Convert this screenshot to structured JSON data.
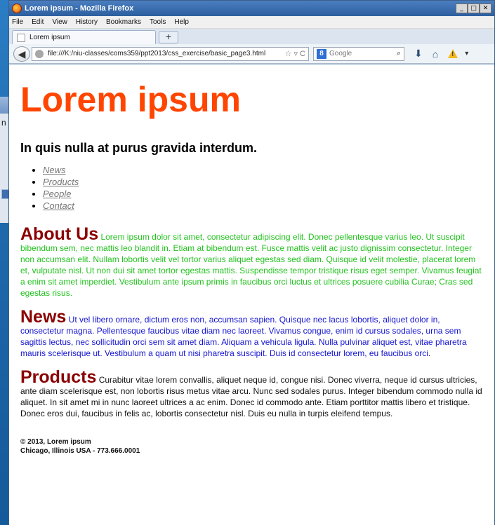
{
  "window": {
    "title": "Lorem ipsum - Mozilla Firefox",
    "controls": {
      "minimize": "_",
      "maximize": "□",
      "close": "✕"
    }
  },
  "menu": [
    {
      "label": "File"
    },
    {
      "label": "Edit"
    },
    {
      "label": "View"
    },
    {
      "label": "History"
    },
    {
      "label": "Bookmarks"
    },
    {
      "label": "Tools"
    },
    {
      "label": "Help"
    }
  ],
  "tab": {
    "title": "Lorem ipsum",
    "new_tab": "+"
  },
  "navbar": {
    "url": "file:///K:/niu-classes/coms359/ppt2013/css_exercise/basic_page3.html",
    "search_placeholder": "Google",
    "search_engine_badge": "8"
  },
  "page": {
    "title": "Lorem ipsum",
    "subtitle": "In quis nulla at purus gravida interdum.",
    "nav": [
      "News",
      "Products",
      "People",
      "Contact"
    ],
    "about": {
      "heading": "About Us",
      "text": "Lorem ipsum dolor sit amet, consectetur adipiscing elit. Donec pellentesque varius leo. Ut suscipit bibendum sem, nec mattis leo blandit in. Etiam at bibendum est. Fusce mattis velit ac justo dignissim consectetur. Integer non accumsan elit. Nullam lobortis velit vel tortor varius aliquet egestas sed diam. Quisque id velit molestie, placerat lorem et, vulputate nisl. Ut non dui sit amet tortor egestas mattis. Suspendisse tempor tristique risus eget semper. Vivamus feugiat a enim sit amet imperdiet. Vestibulum ante ipsum primis in faucibus orci luctus et ultrices posuere cubilia Curae; Cras sed egestas risus."
    },
    "news": {
      "heading": "News",
      "text": "Ut vel libero ornare, dictum eros non, accumsan sapien. Quisque nec lacus lobortis, aliquet dolor in, consectetur magna. Pellentesque faucibus vitae diam nec laoreet. Vivamus congue, enim id cursus sodales, urna sem sagittis lectus, nec sollicitudin orci sem sit amet diam. Aliquam a vehicula ligula. Nulla pulvinar aliquet est, vitae pharetra mauris scelerisque ut. Vestibulum a quam ut nisi pharetra suscipit. Duis id consectetur lorem, eu faucibus orci."
    },
    "products": {
      "heading": "Products",
      "text": "Curabitur vitae lorem convallis, aliquet neque id, congue nisi. Donec viverra, neque id cursus ultricies, ante diam scelerisque est, non lobortis risus metus vitae arcu. Nunc sed sodales purus. Integer bibendum commodo nulla id aliquet. In sit amet mi in nunc laoreet ultrices a ac enim. Donec id commodo ante. Etiam porttitor mattis libero et tristique. Donec eros dui, faucibus in felis ac, lobortis consectetur nisl. Duis eu nulla in turpis eleifend tempus."
    },
    "footer": {
      "line1": "© 2013, Lorem ipsum",
      "line2": "Chicago, Illinois USA - 773.666.0001"
    }
  },
  "colors": {
    "title": "#ff4500",
    "heading": "#8b0000",
    "about_text": "#22c21e",
    "news_text": "#1414d0"
  }
}
